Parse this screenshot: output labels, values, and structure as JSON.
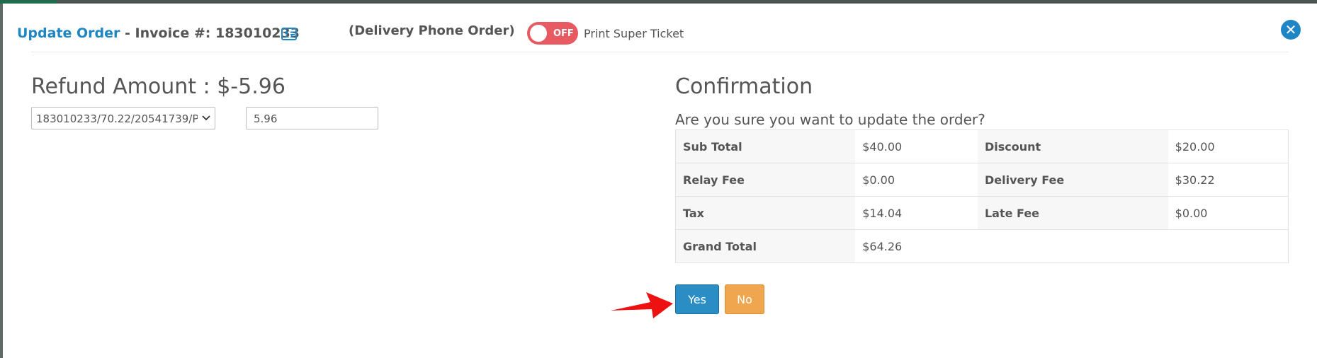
{
  "header": {
    "title_link": "Update Order",
    "title_rest": " - Invoice #: 183010233",
    "order_type": "(Delivery Phone Order)",
    "toggle_state": "OFF",
    "print_label": "Print Super Ticket",
    "close_icon": "close-icon"
  },
  "refund": {
    "title": "Refund Amount : $-5.96",
    "select_value": "183010233/70.22/20541739/P",
    "amount_value": "5.96"
  },
  "confirmation": {
    "title": "Confirmation",
    "question": "Are you sure you want to update the order?",
    "rows": [
      {
        "l1": "Sub Total",
        "v1": "$40.00",
        "l2": "Discount",
        "v2": "$20.00"
      },
      {
        "l1": "Relay Fee",
        "v1": "$0.00",
        "l2": "Delivery Fee",
        "v2": "$30.22"
      },
      {
        "l1": "Tax",
        "v1": "$14.04",
        "l2": "Late Fee",
        "v2": "$0.00"
      },
      {
        "l1": "Grand Total",
        "v1": "$64.26",
        "l2": "",
        "v2": ""
      }
    ],
    "yes_label": "Yes",
    "no_label": "No"
  },
  "colors": {
    "accent": "#1f86c6",
    "toggle_off": "#e85a62",
    "yes_button": "#2a8dc4",
    "no_button": "#efa64f",
    "arrow": "#ee1111"
  }
}
